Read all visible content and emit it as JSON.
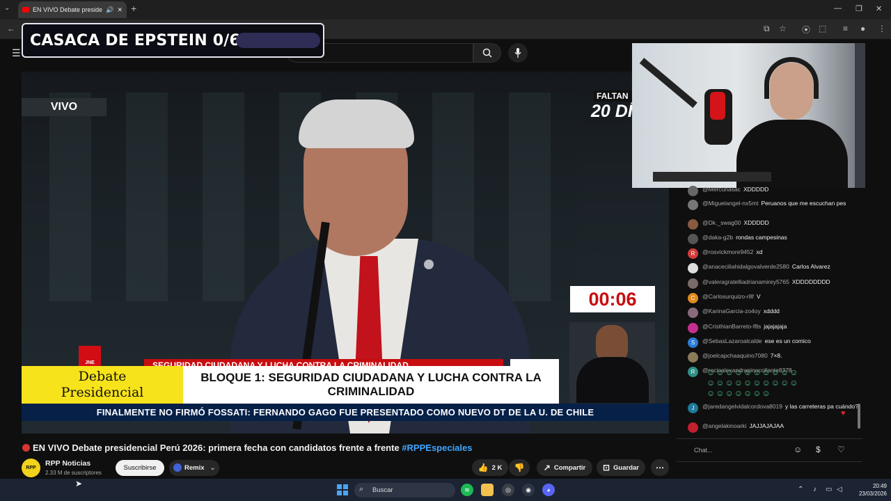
{
  "browser": {
    "tab_title": "EN VIVO Debate preside...",
    "new_tab": "+",
    "menu_icon": "chevron-down-icon"
  },
  "overlay": {
    "title": "CASACA DE EPSTEIN 0/6",
    "pill_color": "#2f2c55"
  },
  "video": {
    "live_label": "VIVO",
    "countdown_top": "FALTAN",
    "countdown_days": "20 DÍ",
    "timer": "00:06",
    "jne_label": "JNE",
    "red_banner": "SEGURIDAD CIUDADANA Y LUCHA CONTRA LA CRIMINALIDAD",
    "lower_third_left_1": "Debate",
    "lower_third_left_2": "Presidencial",
    "lower_third_right": "BLOQUE 1: SEGURIDAD CIUDADANA Y LUCHA CONTRA LA CRIMINALIDAD",
    "ticker": "FINALMENTE NO FIRMÓ FOSSATI: FERNANDO GAGO FUE PRESENTADO COMO NUEVO DT DE LA U. DE CHILE",
    "colors": {
      "timer_red": "#c80d10",
      "lower_yellow": "#f7e31b",
      "ticker_navy": "#062048"
    }
  },
  "chat": {
    "messages": [
      {
        "user": "@Mercunasac",
        "text": "XDDDDD",
        "avatar_color": "#666",
        "avatar_letter": ""
      },
      {
        "user": "@Miguelangel-nx5mt",
        "text": "Peruanos que me escuchan pes",
        "avatar_color": "#777",
        "avatar_letter": ""
      },
      {
        "user": "@Dk._swag00",
        "text": "XDDDDD",
        "avatar_color": "#8a5a40",
        "avatar_letter": ""
      },
      {
        "user": "@daka-g2b",
        "text": "rondas campesinas",
        "avatar_color": "#555",
        "avatar_letter": ""
      },
      {
        "user": "@rosvickmore9452",
        "text": "xd",
        "avatar_color": "#d23c3c",
        "avatar_letter": "R"
      },
      {
        "user": "@anaceciliahidalgovalverde2580",
        "text": "Carlos Alvarez",
        "avatar_color": "#ddd",
        "avatar_letter": ""
      },
      {
        "user": "@valeragratelliadrianamirey5765",
        "text": "XDDDDDDDD",
        "avatar_color": "#7a6a6a",
        "avatar_letter": ""
      },
      {
        "user": "@Carlosurquizo-r8f",
        "text": "V",
        "avatar_color": "#e08a1e",
        "avatar_letter": "C"
      },
      {
        "user": "@KarinaGarcia-zo4oy",
        "text": "xdddd",
        "avatar_color": "#8a6a7a",
        "avatar_letter": ""
      },
      {
        "user": "@CristhianBarreto-f8s",
        "text": "jajajajaja",
        "avatar_color": "#c42f8f",
        "avatar_letter": ""
      },
      {
        "user": "@SebasLazaroalcalde",
        "text": "ese es un comico",
        "avatar_color": "#2b7bd8",
        "avatar_letter": "S"
      },
      {
        "user": "@joelcapchaaquino7080",
        "text": "7×8.",
        "avatar_color": "#8a7a5a",
        "avatar_letter": ""
      },
      {
        "user": "@rocioalexandrapinocollante8378",
        "text": "",
        "avatar_color": "#2e8f86",
        "avatar_letter": "R"
      },
      {
        "user": "@jaredangelvidalcordova8019",
        "text": "y las carreteras pa cuándo?",
        "avatar_color": "#1f7a9a",
        "avatar_letter": "J"
      },
      {
        "user": "@angelakinoarki",
        "text": "JAJJAJAJAA",
        "avatar_color": "#c21f2f",
        "avatar_letter": ""
      }
    ],
    "input_placeholder": "Chat..."
  },
  "video_info": {
    "title": "EN VIVO Debate presidencial Perú 2026: primera fecha con candidatos frente a frente",
    "hashtag": "#RPPEspeciales",
    "channel_name": "RPP Noticias",
    "channel_logo": "RPP",
    "subscribers": "2.33 M de suscriptores",
    "subscribe_label": "Suscribirse",
    "remix_label": "Remix",
    "likes": "2 K",
    "share_label": "Compartir",
    "save_label": "Guardar"
  },
  "taskbar": {
    "search_label": "Buscar",
    "time": "20:49",
    "date": "23/03/2026"
  }
}
